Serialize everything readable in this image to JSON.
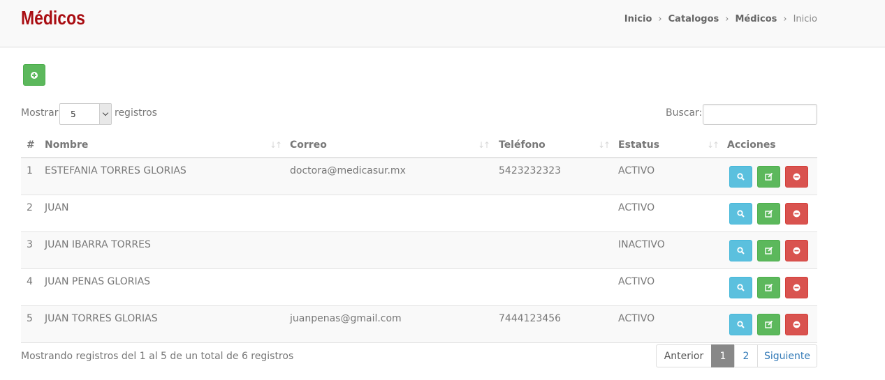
{
  "header": {
    "title": "Médicos",
    "breadcrumb": [
      "Inicio",
      "Catalogos",
      "Médicos",
      "Inicio"
    ]
  },
  "toolbar": {
    "add_icon": "plus-circle-icon"
  },
  "length_control": {
    "prefix": "Mostrar",
    "value": "5",
    "suffix": "registros"
  },
  "search": {
    "label": "Buscar:",
    "value": ""
  },
  "table": {
    "columns": [
      "#",
      "Nombre",
      "Correo",
      "Teléfono",
      "Estatus",
      "Acciones"
    ],
    "rows": [
      {
        "num": "1",
        "nombre": "ESTEFANIA TORRES GLORIAS",
        "correo": "doctora@medicasur.mx",
        "telefono": "5423232323",
        "estatus": "ACTIVO"
      },
      {
        "num": "2",
        "nombre": "JUAN",
        "correo": "",
        "telefono": "",
        "estatus": "ACTIVO"
      },
      {
        "num": "3",
        "nombre": "JUAN IBARRA TORRES",
        "correo": "",
        "telefono": "",
        "estatus": "INACTIVO"
      },
      {
        "num": "4",
        "nombre": "JUAN PENAS GLORIAS",
        "correo": "",
        "telefono": "",
        "estatus": "ACTIVO"
      },
      {
        "num": "5",
        "nombre": "JUAN TORRES GLORIAS",
        "correo": "juanpenas@gmail.com",
        "telefono": "7444123456",
        "estatus": "ACTIVO"
      }
    ]
  },
  "footer": {
    "info": "Mostrando registros del 1 al 5 de un total de 6 registros",
    "pagination": {
      "prev": "Anterior",
      "pages": [
        "1",
        "2"
      ],
      "active": "1",
      "next": "Siguiente"
    }
  },
  "colors": {
    "title": "#a90d12",
    "success": "#5cb85c",
    "info": "#5bc0de",
    "danger": "#d9534f"
  }
}
